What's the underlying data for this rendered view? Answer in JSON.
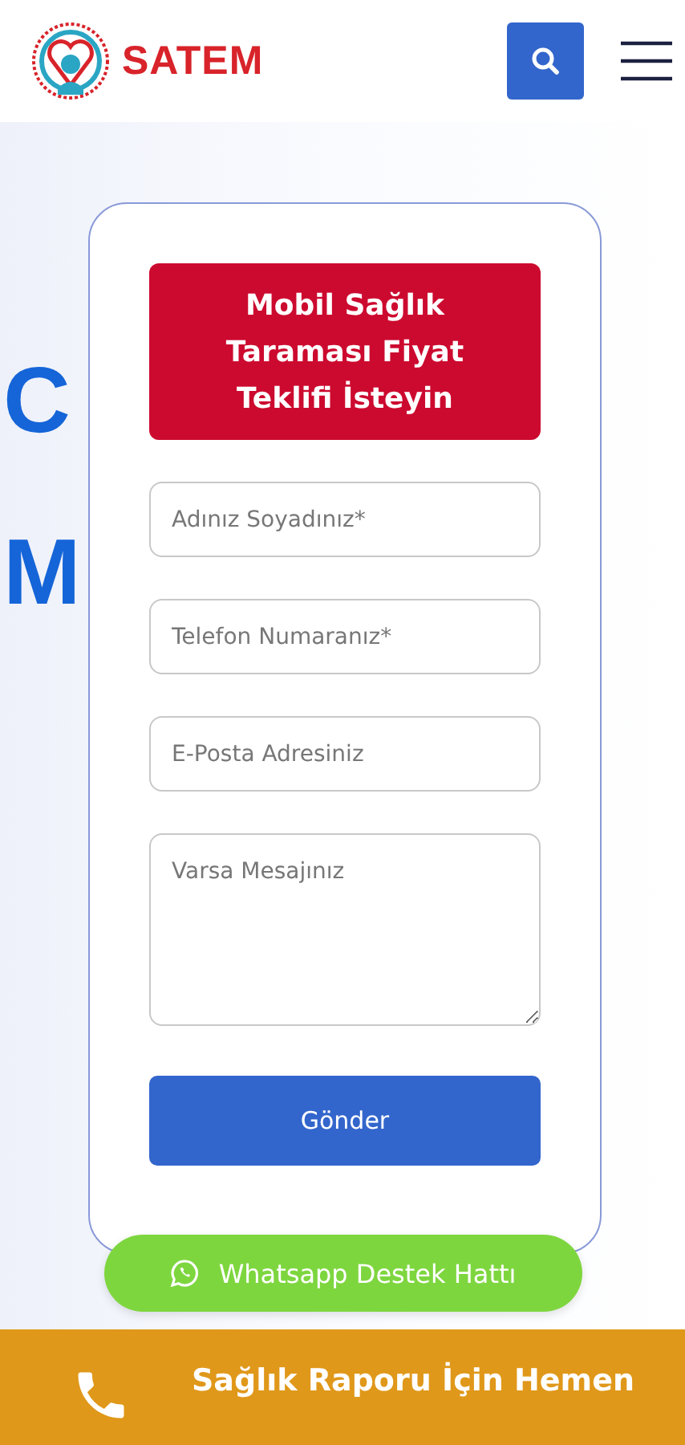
{
  "header": {
    "brand": "SATEM"
  },
  "hero": {
    "lines": [
      "C",
      "M"
    ]
  },
  "form": {
    "title": "Mobil Sağlık Taraması Fiyat Teklifi İsteyin",
    "fields": [
      {
        "kind": "input",
        "placeholder": "Adınız Soyadınız*"
      },
      {
        "kind": "input",
        "placeholder": "Telefon Numaranız*"
      },
      {
        "kind": "input",
        "placeholder": "E-Posta Adresiniz"
      },
      {
        "kind": "textarea",
        "placeholder": "Varsa Mesajınız"
      }
    ],
    "submit": "Gönder"
  },
  "whatsapp": {
    "label": "Whatsapp Destek Hattı"
  },
  "call_bar": {
    "label": "Sağlık Raporu İçin Hemen"
  }
}
